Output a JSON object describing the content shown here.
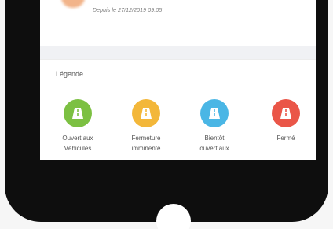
{
  "status": {
    "since_text": "Depuis le 27/12/2019 09:05"
  },
  "legend": {
    "title": "Légende",
    "items": [
      {
        "label": "Ouvert aux\nVéhicules",
        "color": "#7cc042",
        "icon": "road-icon"
      },
      {
        "label": "Fermeture\nimminente",
        "color": "#f3b73a",
        "icon": "road-icon"
      },
      {
        "label": "Bientôt\nouvert aux",
        "color": "#4ab6e5",
        "icon": "road-icon"
      },
      {
        "label": "Fermé",
        "color": "#ea5648",
        "icon": "road-icon"
      }
    ]
  }
}
